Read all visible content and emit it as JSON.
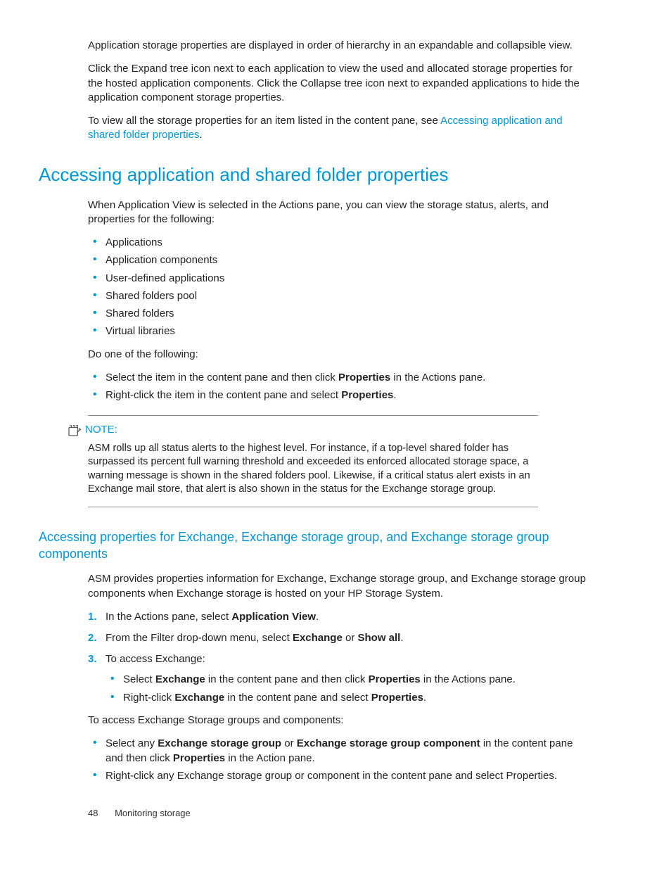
{
  "intro": {
    "p1": "Application storage properties are displayed in order of hierarchy in an expandable and collapsible view.",
    "p2": "Click the Expand tree icon next to each application to view the used and allocated storage properties for the hosted application components. Click the Collapse tree icon next to expanded applications to hide the application component storage properties.",
    "p3a": "To view all the storage properties for an item listed in the content pane, see ",
    "p3link": "Accessing application and shared folder properties",
    "p3b": "."
  },
  "section1": {
    "title": "Accessing application and shared folder properties",
    "p1": "When Application View is selected in the Actions pane, you can view the storage status, alerts, and properties for the following:",
    "bullets1": [
      "Applications",
      "Application components",
      "User-defined applications",
      "Shared folders pool",
      "Shared folders",
      "Virtual libraries"
    ],
    "p2": "Do one of the following:",
    "action1_a": "Select the item in the content pane and then click ",
    "action1_b": "Properties",
    "action1_c": " in the Actions pane.",
    "action2_a": "Right-click the item in the content pane and select ",
    "action2_b": "Properties",
    "action2_c": "."
  },
  "note": {
    "label": "NOTE:",
    "text": "ASM rolls up all status alerts to the highest level. For instance, if a top-level shared folder has surpassed its percent full warning threshold and exceeded its enforced allocated storage space, a warning message is shown in the shared folders pool. Likewise, if a critical status alert exists in an Exchange mail store, that alert is also shown in the status for the Exchange storage group."
  },
  "section2": {
    "title": "Accessing properties for Exchange, Exchange storage group, and Exchange storage group components",
    "p1": "ASM provides properties information for Exchange, Exchange storage group, and Exchange storage group components when Exchange storage is hosted on your HP Storage System.",
    "step1_a": "In the Actions pane, select ",
    "step1_b": "Application View",
    "step1_c": ".",
    "step2_a": "From the Filter drop-down menu, select ",
    "step2_b": "Exchange",
    "step2_c": " or ",
    "step2_d": "Show all",
    "step2_e": ".",
    "step3": "To access Exchange:",
    "step3i1_a": "Select ",
    "step3i1_b": "Exchange",
    "step3i1_c": " in the content pane and then click ",
    "step3i1_d": "Properties",
    "step3i1_e": " in the Actions pane.",
    "step3i2_a": "Right-click ",
    "step3i2_b": "Exchange",
    "step3i2_c": " in the content pane and select ",
    "step3i2_d": "Properties",
    "step3i2_e": ".",
    "p2": "To access Exchange Storage groups and components:",
    "b1_a": "Select any ",
    "b1_b": "Exchange storage group",
    "b1_c": " or ",
    "b1_d": "Exchange storage group component",
    "b1_e": " in the content pane and then click ",
    "b1_f": "Properties",
    "b1_g": " in the Action pane.",
    "b2": "Right-click any Exchange storage group or component in the content pane and select Properties."
  },
  "footer": {
    "page": "48",
    "chapter": "Monitoring storage"
  }
}
